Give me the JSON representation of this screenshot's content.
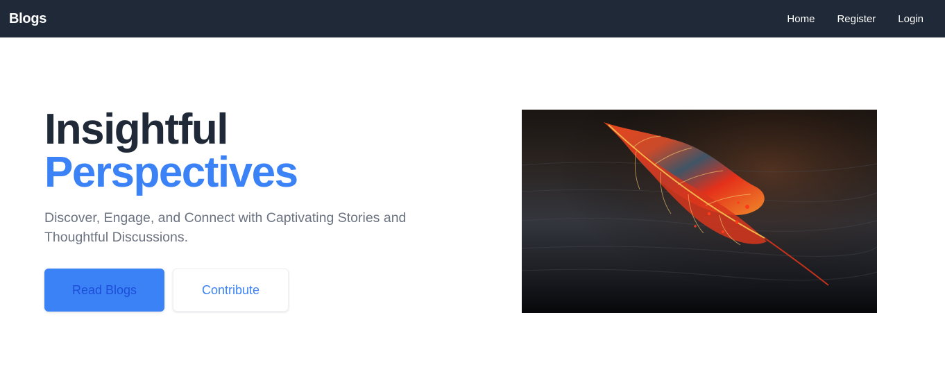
{
  "navbar": {
    "brand": "Blogs",
    "links": [
      "Home",
      "Register",
      "Login"
    ],
    "background": "#1f2937"
  },
  "hero": {
    "title_line1": "Insightful",
    "title_line2": "Perspectives",
    "subtitle": "Discover, Engage, and Connect with Captivating Stories and Thoughtful Discussions.",
    "primary_button": "Read Blogs",
    "secondary_button": "Contribute",
    "accent_color": "#3b82f6",
    "heading_color": "#1f2937"
  },
  "image": {
    "subject": "red-autumn-leaf-on-dark-wood"
  }
}
